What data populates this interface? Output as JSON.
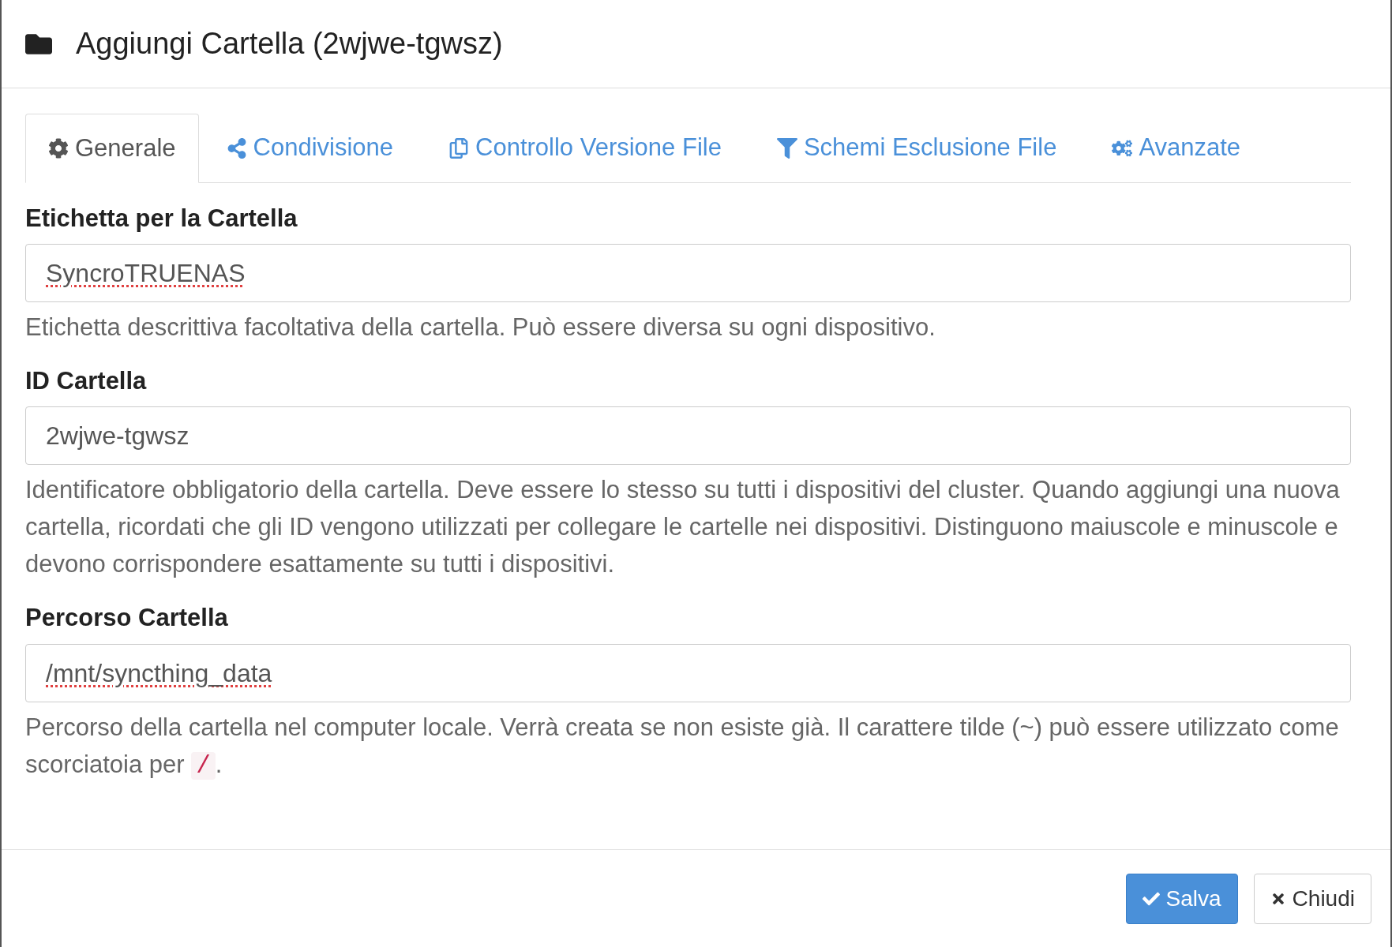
{
  "title": "Aggiungi Cartella (2wjwe-tgwsz)",
  "tabs": [
    {
      "label": "Generale",
      "selected": true
    },
    {
      "label": "Condivisione",
      "selected": false
    },
    {
      "label": "Controllo Versione File",
      "selected": false
    },
    {
      "label": "Schemi Esclusione File",
      "selected": false
    },
    {
      "label": "Avanzate",
      "selected": false
    }
  ],
  "fields": [
    {
      "label": "Etichetta per la Cartella",
      "value": "SyncroTRUENAS",
      "misspelled": true,
      "help": "Etichetta descrittiva facoltativa della cartella. Può essere diversa su ogni dispositivo."
    },
    {
      "label": "ID Cartella",
      "value": "2wjwe-tgwsz",
      "misspelled": false,
      "help": "Identificatore obbligatorio della cartella. Deve essere lo stesso su tutti i dispositivi del cluster. Quando aggiungi una nuova cartella, ricordati che gli ID vengono utilizzati per collegare le cartelle nei dispositivi. Distinguono maiuscole e minuscole e devono corrispondere esattamente su tutti i dispositivi."
    },
    {
      "label": "Percorso Cartella",
      "value": "/mnt/syncthing_data",
      "misspelled": true,
      "help": "Percorso della cartella nel computer locale. Verrà creata se non esiste già. Il carattere tilde (~) può essere utilizzato come scorciatoia per ",
      "help_code": "/",
      "help_after": "."
    }
  ],
  "buttons": [
    {
      "label": "Salva",
      "kind": "primary"
    },
    {
      "label": "Chiudi",
      "kind": "default"
    }
  ]
}
